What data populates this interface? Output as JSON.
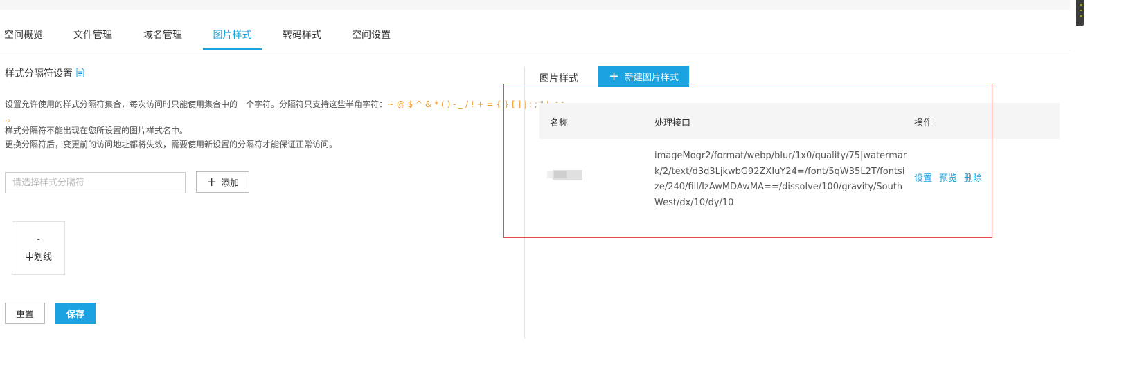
{
  "tabs": [
    {
      "label": "空间概览",
      "active": false
    },
    {
      "label": "文件管理",
      "active": false
    },
    {
      "label": "域名管理",
      "active": false
    },
    {
      "label": "图片样式",
      "active": true
    },
    {
      "label": "转码样式",
      "active": false
    },
    {
      "label": "空间设置",
      "active": false
    }
  ],
  "separator": {
    "title": "样式分隔符设置",
    "title_icon": "document-icon",
    "desc1_prefix": "设置允许使用的样式分隔符集合，每次访问时只能使用集合中的一个字符。分隔符只支持这些半角字符：",
    "desc1_chars": "~ @ $ ^ & * ( ) - _ / ! + = { } [ ] | : ; \" ' < >",
    "desc1_cont": ",。",
    "desc2": "样式分隔符不能出现在您所设置的图片样式名中。",
    "desc3": "更换分隔符后，变更前的访问地址都将失效，需要使用新设置的分隔符才能保证正常访问。",
    "input_placeholder": "请选择样式分隔符",
    "input_value": "",
    "add_label": "添加",
    "chip": {
      "symbol": "-",
      "name": "中划线"
    },
    "reset_label": "重置",
    "save_label": "保存"
  },
  "styles": {
    "title": "图片样式",
    "new_label": "新建图片样式",
    "columns": {
      "name": "名称",
      "api": "处理接口",
      "ops": "操作"
    },
    "row": {
      "api_lines": [
        "imageMogr2/format/webp/blur/1x0/quality/75|watermar",
        "k/2/text/d3d3LjkwbG92ZXIuY24=/font/5qW35L2T/fontsi",
        "ze/240/fill/IzAwMDAwMA==/dissolve/100/gravity/South",
        "West/dx/10/dy/10"
      ],
      "ops": [
        "设置",
        "预览",
        "删除"
      ]
    }
  },
  "colors": {
    "accent": "#1aa3e0",
    "highlight": "#f29c2b",
    "annotation": "#e84b4b"
  }
}
